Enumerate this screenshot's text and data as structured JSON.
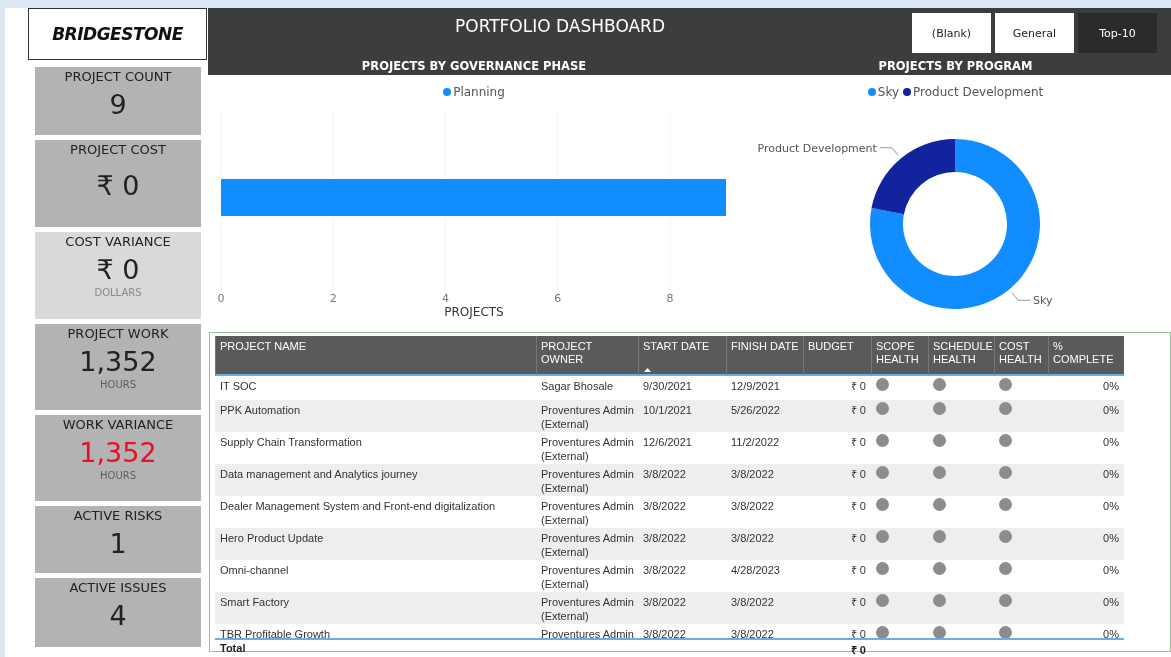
{
  "logo": "BRIDGESTONE",
  "kpis": [
    {
      "title": "PROJECT COUNT",
      "value": "9",
      "highlight": false,
      "dimmed": false
    },
    {
      "title": "PROJECT COST",
      "value": "₹ 0",
      "highlight": false,
      "dimmed": false
    },
    {
      "title": "COST VARIANCE",
      "value": "₹ 0",
      "unit": "DOLLARS",
      "highlight": false,
      "dimmed": true
    },
    {
      "title": "PROJECT WORK",
      "value": "1,352",
      "unit": "HOURS",
      "highlight": false,
      "dimmed": false
    },
    {
      "title": "WORK VARIANCE",
      "value": "1,352",
      "unit": "HOURS",
      "highlight": true,
      "dimmed": false
    },
    {
      "title": "ACTIVE RISKS",
      "value": "1",
      "highlight": false,
      "dimmed": false
    },
    {
      "title": "ACTIVE ISSUES",
      "value": "4",
      "highlight": false,
      "dimmed": false
    }
  ],
  "header": {
    "title": "PORTFOLIO DASHBOARD",
    "filters": [
      {
        "label": "(Blank)",
        "selected": false
      },
      {
        "label": "General",
        "selected": false
      },
      {
        "label": "Top-10",
        "selected": true
      }
    ]
  },
  "charts": [
    {
      "title": "PROJECTS BY GOVERNANCE PHASE",
      "chart_data": {
        "type": "bar",
        "orientation": "horizontal",
        "xlabel": "PROJECTS",
        "grid": true,
        "series": [
          {
            "name": "Planning",
            "color": "#118dff",
            "values": [
              9
            ]
          }
        ],
        "xlim": [
          0,
          9
        ],
        "xticks": [
          0,
          2,
          4,
          6,
          8
        ]
      }
    },
    {
      "title": "PROJECTS BY PROGRAM",
      "chart_data": {
        "type": "donut",
        "categories": [
          "Sky",
          "Product Development"
        ],
        "series": [
          {
            "values": [
              78,
              22
            ]
          }
        ],
        "colors": [
          "#118dff",
          "#12239e"
        ]
      }
    }
  ],
  "table": {
    "columns": [
      {
        "label": "PROJECT NAME",
        "kind": "text",
        "sorted": false
      },
      {
        "label": "PROJECT OWNER",
        "kind": "text",
        "sorted": false
      },
      {
        "label": "START DATE",
        "kind": "text",
        "sorted": true
      },
      {
        "label": "FINISH DATE",
        "kind": "text",
        "sorted": false
      },
      {
        "label": "BUDGET",
        "kind": "number",
        "sorted": false
      },
      {
        "label": "SCOPE HEALTH",
        "kind": "status",
        "sorted": false
      },
      {
        "label": "SCHEDULE HEALTH",
        "kind": "status",
        "sorted": false
      },
      {
        "label": "COST HEALTH",
        "kind": "status",
        "sorted": false
      },
      {
        "label": "% COMPLETE",
        "kind": "number",
        "sorted": false
      }
    ],
    "rows": [
      {
        "cells": [
          [
            "IT SOC"
          ],
          [
            "Sagar Bhosale"
          ],
          [
            "9/30/2021"
          ],
          [
            "12/9/2021"
          ],
          [
            "₹ 0"
          ],
          [],
          [],
          [],
          [
            "0%"
          ]
        ]
      },
      {
        "cells": [
          [
            "PPK Automation"
          ],
          [
            "Proventures Admin",
            "(External)"
          ],
          [
            "10/1/2021"
          ],
          [
            "5/26/2022"
          ],
          [
            "₹ 0"
          ],
          [],
          [],
          [],
          [
            "0%"
          ]
        ]
      },
      {
        "cells": [
          [
            "Supply Chain Transformation"
          ],
          [
            "Proventures Admin",
            "(External)"
          ],
          [
            "12/6/2021"
          ],
          [
            "11/2/2022"
          ],
          [
            "₹ 0"
          ],
          [],
          [],
          [],
          [
            "0%"
          ]
        ]
      },
      {
        "cells": [
          [
            "Data management and Analytics journey"
          ],
          [
            "Proventures Admin",
            "(External)"
          ],
          [
            "3/8/2022"
          ],
          [
            "3/8/2022"
          ],
          [
            "₹ 0"
          ],
          [],
          [],
          [],
          [
            "0%"
          ]
        ]
      },
      {
        "cells": [
          [
            "Dealer Management System and Front-end digitalization"
          ],
          [
            "Proventures Admin",
            "(External)"
          ],
          [
            "3/8/2022"
          ],
          [
            "3/8/2022"
          ],
          [
            "₹ 0"
          ],
          [],
          [],
          [],
          [
            "0%"
          ]
        ]
      },
      {
        "cells": [
          [
            "Hero Product Update"
          ],
          [
            "Proventures Admin",
            "(External)"
          ],
          [
            "3/8/2022"
          ],
          [
            "3/8/2022"
          ],
          [
            "₹ 0"
          ],
          [],
          [],
          [],
          [
            "0%"
          ]
        ]
      },
      {
        "cells": [
          [
            "Omni-channel"
          ],
          [
            "Proventures Admin",
            "(External)"
          ],
          [
            "3/8/2022"
          ],
          [
            "4/28/2023"
          ],
          [
            "₹ 0"
          ],
          [],
          [],
          [],
          [
            "0%"
          ]
        ]
      },
      {
        "cells": [
          [
            "Smart Factory"
          ],
          [
            "Proventures Admin",
            "(External)"
          ],
          [
            "3/8/2022"
          ],
          [
            "3/8/2022"
          ],
          [
            "₹ 0"
          ],
          [],
          [],
          [],
          [
            "0%"
          ]
        ]
      },
      {
        "cells": [
          [
            "TBR Profitable Growth"
          ],
          [
            "Proventures Admin"
          ],
          [
            "3/8/2022"
          ],
          [
            "3/8/2022"
          ],
          [
            "₹ 0"
          ],
          [],
          [],
          [],
          [
            "0%"
          ]
        ]
      }
    ],
    "total": {
      "label": "Total",
      "budget": "₹ 0"
    }
  }
}
